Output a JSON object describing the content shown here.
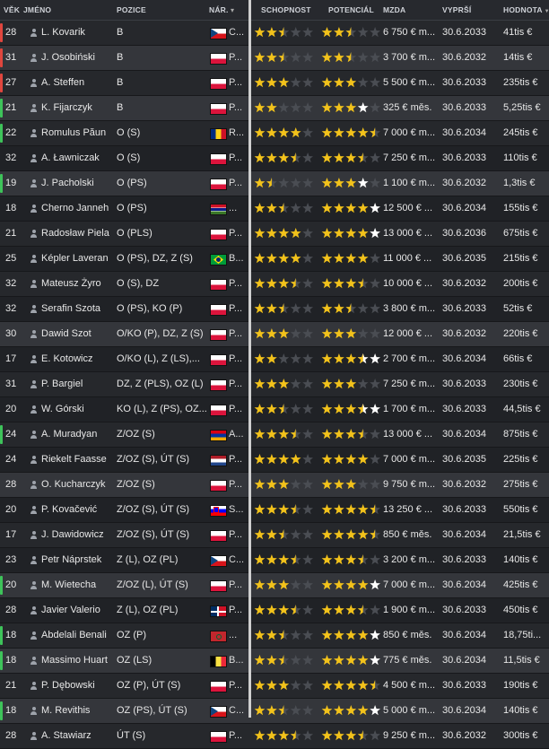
{
  "columns": {
    "age": "VĚK",
    "name": "JMÉNO",
    "position": "POZICE",
    "nationality": "NÁR.",
    "ability": "SCHOPNOST",
    "potential": "POTENCIÁL",
    "wage": "MZDA",
    "expires": "VYPRŠÍ",
    "value": "HODNOTA"
  },
  "colors": {
    "accent_red": "#e0463e",
    "accent_green": "#3ec35a",
    "star_gold": "#f2c21b",
    "star_white": "#ffffff",
    "star_empty": "#4a4d53"
  },
  "players": [
    {
      "age": "28",
      "name": "L. Kovarik",
      "position": "B",
      "flag": "cz",
      "nat": "C...",
      "ability": 2.5,
      "potential": 2.5,
      "wage": "6 750 € m...",
      "expires": "30.6.2033",
      "value": "41tis €",
      "accent": "red",
      "sel": false
    },
    {
      "age": "31",
      "name": "J. Osobiński",
      "position": "B",
      "flag": "pl",
      "nat": "P...",
      "ability": 2.5,
      "potential": 2.5,
      "wage": "3 700 € m...",
      "expires": "30.6.2032",
      "value": "14tis €",
      "accent": "red",
      "sel": true
    },
    {
      "age": "27",
      "name": "A. Steffen",
      "position": "B",
      "flag": "pl",
      "nat": "P...",
      "ability": 3,
      "potential": 3,
      "wage": "5 500 € m...",
      "expires": "30.6.2033",
      "value": "235tis €",
      "accent": "red",
      "sel": false
    },
    {
      "age": "21",
      "name": "K. Fijarczyk",
      "position": "B",
      "flag": "pl",
      "nat": "P...",
      "ability": 2,
      "potential": 3,
      "potential_white": 1,
      "wage": "325 € měs.",
      "expires": "30.6.2033",
      "value": "5,25tis €",
      "accent": "green",
      "sel": true
    },
    {
      "age": "22",
      "name": "Romulus Păun",
      "position": "O (S)",
      "flag": "ro",
      "nat": "R...",
      "ability": 4,
      "potential": 4.5,
      "wage": "7 000 € m...",
      "expires": "30.6.2034",
      "value": "245tis €",
      "accent": "green",
      "sel": false
    },
    {
      "age": "32",
      "name": "A. Ławniczak",
      "position": "O (S)",
      "flag": "pl",
      "nat": "P...",
      "ability": 3.5,
      "potential": 3.5,
      "wage": "7 250 € m...",
      "expires": "30.6.2033",
      "value": "110tis €",
      "accent": "none",
      "sel": false
    },
    {
      "age": "19",
      "name": "J. Pacholski",
      "position": "O (PS)",
      "flag": "pl",
      "nat": "P...",
      "ability": 1.5,
      "potential": 3,
      "potential_white": 1,
      "wage": "1 100 € m...",
      "expires": "30.6.2032",
      "value": "1,3tis €",
      "accent": "green",
      "sel": true
    },
    {
      "age": "18",
      "name": "Cherno Janneh",
      "position": "O (PS)",
      "flag": "gm",
      "nat": "...",
      "ability": 2.5,
      "potential": 4,
      "potential_white": 1,
      "wage": "12 500 € ...",
      "expires": "30.6.2034",
      "value": "155tis €",
      "accent": "none",
      "sel": false
    },
    {
      "age": "21",
      "name": "Radosław Piela",
      "position": "O (PLS)",
      "flag": "pl",
      "nat": "P...",
      "ability": 4,
      "potential": 4,
      "potential_white": 1,
      "wage": "13 000 € ...",
      "expires": "30.6.2036",
      "value": "675tis €",
      "accent": "none",
      "sel": false
    },
    {
      "age": "25",
      "name": "Képler Laveran",
      "position": "O (PS), DZ, Z (S)",
      "flag": "br",
      "nat": "B...",
      "ability": 4,
      "potential": 4,
      "wage": "11 000 € ...",
      "expires": "30.6.2035",
      "value": "215tis €",
      "accent": "none",
      "sel": false
    },
    {
      "age": "32",
      "name": "Mateusz Żyro",
      "position": "O (S), DZ",
      "flag": "pl",
      "nat": "P...",
      "ability": 3.5,
      "potential": 3.5,
      "wage": "10 000 € ...",
      "expires": "30.6.2032",
      "value": "200tis €",
      "accent": "none",
      "sel": false
    },
    {
      "age": "32",
      "name": "Serafin Szota",
      "position": "O (PS), KO (P)",
      "flag": "pl",
      "nat": "P...",
      "ability": 2.5,
      "potential": 2.5,
      "wage": "3 800 € m...",
      "expires": "30.6.2033",
      "value": "52tis €",
      "accent": "none",
      "sel": false
    },
    {
      "age": "30",
      "name": "Dawid Szot",
      "position": "O/KO (P), DZ, Z (S)",
      "flag": "pl",
      "nat": "P...",
      "ability": 3,
      "potential": 3,
      "wage": "12 000 € ...",
      "expires": "30.6.2032",
      "value": "220tis €",
      "accent": "none",
      "sel": true
    },
    {
      "age": "17",
      "name": "E. Kotowicz",
      "position": "O/KO (L), Z (LS),...",
      "flag": "pl",
      "nat": "P...",
      "ability": 2,
      "potential": 3.5,
      "potential_white": 1,
      "wage": "2 700 € m...",
      "expires": "30.6.2034",
      "value": "66tis €",
      "accent": "none",
      "sel": false
    },
    {
      "age": "31",
      "name": "P. Bargiel",
      "position": "DZ, Z (PLS), OZ (L)",
      "flag": "pl",
      "nat": "P...",
      "ability": 3,
      "potential": 3,
      "wage": "7 250 € m...",
      "expires": "30.6.2033",
      "value": "230tis €",
      "accent": "none",
      "sel": false
    },
    {
      "age": "20",
      "name": "W. Górski",
      "position": "KO (L), Z (PS), OZ...",
      "flag": "pl",
      "nat": "P...",
      "ability": 2.5,
      "potential": 3.5,
      "potential_white": 1,
      "wage": "1 700 € m...",
      "expires": "30.6.2033",
      "value": "44,5tis €",
      "accent": "none",
      "sel": false
    },
    {
      "age": "24",
      "name": "A. Muradyan",
      "position": "Z/OZ (S)",
      "flag": "am",
      "nat": "A...",
      "ability": 3.5,
      "potential": 3.5,
      "wage": "13 000 € ...",
      "expires": "30.6.2034",
      "value": "875tis €",
      "accent": "green",
      "sel": false
    },
    {
      "age": "24",
      "name": "Riekelt Faasse",
      "position": "Z/OZ (S), ÚT (S)",
      "flag": "nl",
      "nat": "P...",
      "ability": 4,
      "potential": 4,
      "wage": "7 000 € m...",
      "expires": "30.6.2035",
      "value": "225tis €",
      "accent": "none",
      "sel": false
    },
    {
      "age": "28",
      "name": "O. Kucharczyk",
      "position": "Z/OZ (S)",
      "flag": "pl",
      "nat": "P...",
      "ability": 3,
      "potential": 3,
      "wage": "9 750 € m...",
      "expires": "30.6.2032",
      "value": "275tis €",
      "accent": "none",
      "sel": true
    },
    {
      "age": "20",
      "name": "P. Kovačević",
      "position": "Z/OZ (S), ÚT (S)",
      "flag": "si",
      "nat": "S...",
      "ability": 3.5,
      "potential": 4.5,
      "wage": "13 250 € ...",
      "expires": "30.6.2033",
      "value": "550tis €",
      "accent": "none",
      "sel": false
    },
    {
      "age": "17",
      "name": "J. Dawidowicz",
      "position": "Z/OZ (S), ÚT (S)",
      "flag": "pl",
      "nat": "P...",
      "ability": 2.5,
      "potential": 4.5,
      "wage": "850 € měs.",
      "expires": "30.6.2034",
      "value": "21,5tis €",
      "accent": "none",
      "sel": false
    },
    {
      "age": "23",
      "name": "Petr Náprstek",
      "position": "Z (L), OZ (PL)",
      "flag": "cz",
      "nat": "C...",
      "ability": 3.5,
      "potential": 3.5,
      "wage": "3 200 € m...",
      "expires": "30.6.2033",
      "value": "140tis €",
      "accent": "none",
      "sel": false
    },
    {
      "age": "20",
      "name": "M. Wietecha",
      "position": "Z/OZ (L), ÚT (S)",
      "flag": "pl",
      "nat": "P...",
      "ability": 3,
      "potential": 4,
      "potential_white": 1,
      "wage": "7 000 € m...",
      "expires": "30.6.2034",
      "value": "425tis €",
      "accent": "green",
      "sel": true
    },
    {
      "age": "28",
      "name": "Javier Valerio",
      "position": "Z (L), OZ (PL)",
      "flag": "do",
      "nat": "P...",
      "ability": 3.5,
      "potential": 3.5,
      "wage": "1 900 € m...",
      "expires": "30.6.2033",
      "value": "450tis €",
      "accent": "none",
      "sel": false
    },
    {
      "age": "18",
      "name": "Abdelali Benali",
      "position": "OZ (P)",
      "flag": "ma",
      "nat": "...",
      "ability": 2.5,
      "potential": 4,
      "potential_white": 1,
      "wage": "850 € měs.",
      "expires": "30.6.2034",
      "value": "18,75ti...",
      "accent": "green",
      "sel": false
    },
    {
      "age": "18",
      "name": "Massimo Huart",
      "position": "OZ (LS)",
      "flag": "be",
      "nat": "B...",
      "ability": 2.5,
      "potential": 4,
      "potential_white": 1,
      "wage": "775 € měs.",
      "expires": "30.6.2034",
      "value": "11,5tis €",
      "accent": "green",
      "sel": true
    },
    {
      "age": "21",
      "name": "P. Dębowski",
      "position": "OZ (P), ÚT (S)",
      "flag": "pl",
      "nat": "P...",
      "ability": 3,
      "potential": 4.5,
      "wage": "4 500 € m...",
      "expires": "30.6.2033",
      "value": "190tis €",
      "accent": "none",
      "sel": false
    },
    {
      "age": "18",
      "name": "M. Revithis",
      "position": "OZ (PS), ÚT (S)",
      "flag": "cz",
      "nat": "C...",
      "ability": 2.5,
      "potential": 4,
      "potential_white": 1,
      "wage": "5 000 € m...",
      "expires": "30.6.2034",
      "value": "140tis €",
      "accent": "green",
      "sel": true
    },
    {
      "age": "28",
      "name": "A. Stawiarz",
      "position": "ÚT (S)",
      "flag": "pl",
      "nat": "P...",
      "ability": 3.5,
      "potential": 3.5,
      "wage": "9 250 € m...",
      "expires": "30.6.2032",
      "value": "300tis €",
      "accent": "none",
      "sel": false
    }
  ]
}
